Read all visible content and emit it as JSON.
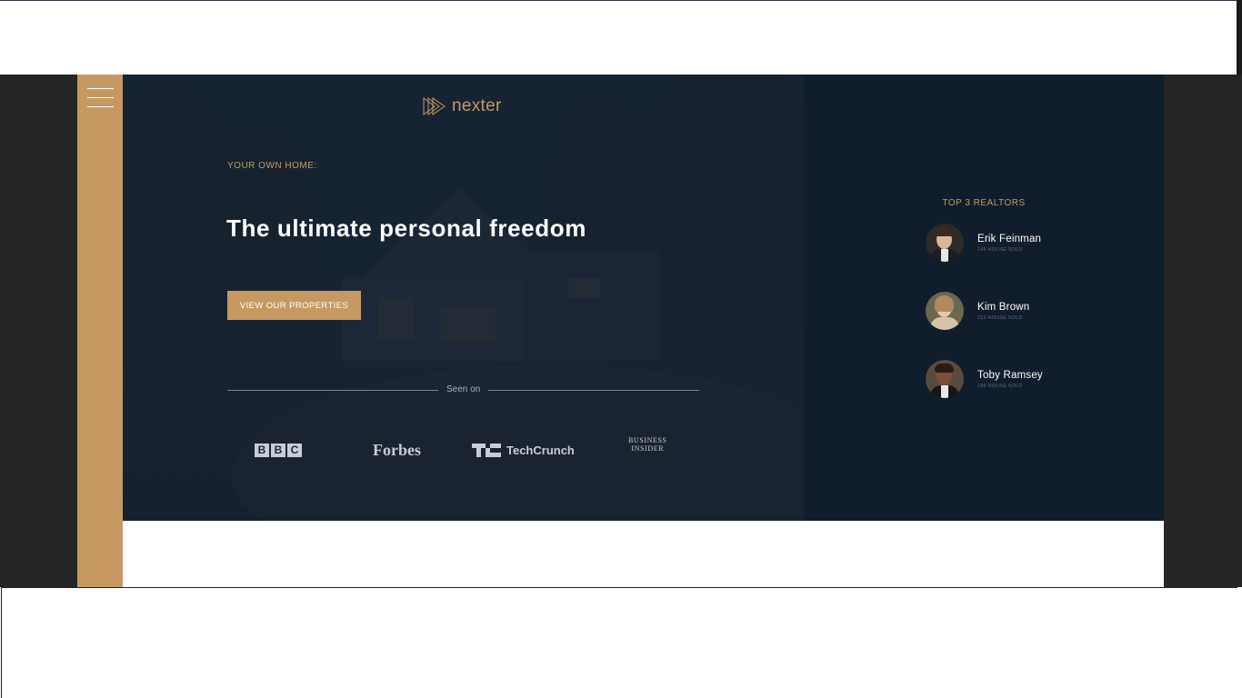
{
  "brand": {
    "name": "nexter",
    "accent_color": "#c69963",
    "dark_color": "#101d2c"
  },
  "navigation": {
    "menu_icon": "hamburger-menu-icon"
  },
  "hero": {
    "eyebrow": "YOUR OWN HOME:",
    "headline": "The ultimate personal freedom",
    "cta_label": "VIEW OUR PROPERTIES",
    "seen_on_label": "Seen on",
    "press": [
      {
        "name": "BBC",
        "letters": [
          "B",
          "B",
          "C"
        ]
      },
      {
        "name": "Forbes"
      },
      {
        "name": "TechCrunch"
      },
      {
        "name": "Business Insider",
        "line1": "BUSINESS",
        "line2": "INSIDER"
      }
    ]
  },
  "realtors": {
    "title": "TOP 3 REALTORS",
    "items": [
      {
        "name": "Erik Feinman",
        "sold": "245 HOUSE SOLD"
      },
      {
        "name": "Kim Brown",
        "sold": "212 HOUSE SOLD"
      },
      {
        "name": "Toby Ramsey",
        "sold": "198 HOUSE SOLD"
      }
    ]
  }
}
